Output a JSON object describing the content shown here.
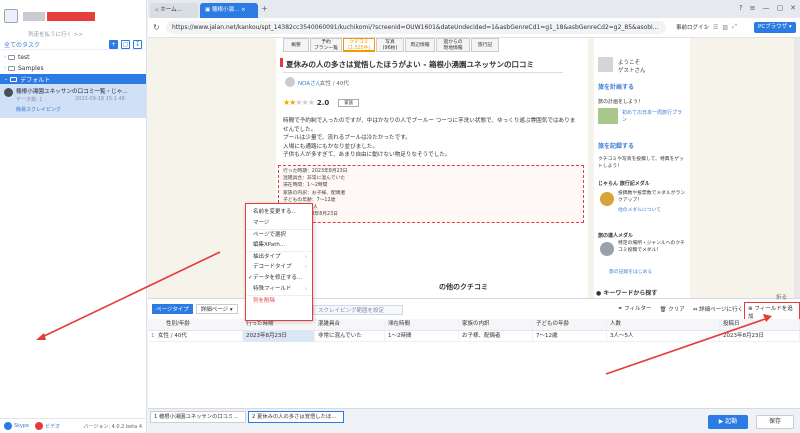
{
  "sidebar": {
    "subtitle": "列走を払うに行く >>",
    "tasks_header": "全てのタスク",
    "tree": [
      "test",
      "Samples",
      "デフォルト"
    ],
    "task": {
      "title": "穂根小湯園ユネッサンの口コミ一覧・じゃ...",
      "status": "データ数: 1",
      "date": "2023-09-18 15:1 48",
      "tag": "簡易スクレイピング"
    },
    "footer": {
      "skype": "Skype",
      "video": "ビデオ",
      "version": "バージョン: 4.0.2 beta 4"
    }
  },
  "browser": {
    "tabs": [
      "ホーム...",
      "穂根小湯..."
    ],
    "new_tab": "+",
    "url": "https://www.jalan.net/kankou/spt_14382cc3540060091/kuchikomi/?screenid=OUW1601&dateUndecided=1&asbGenreCd1=g1_18&asbGenreCd2=g2_85&asobi...",
    "login": "事前ログイン",
    "pc_browser": "PCブラウザ"
  },
  "page": {
    "nav": [
      [
        "概要",
        ""
      ],
      [
        "予約",
        "プラン一覧"
      ],
      [
        "クチコミ",
        "(2,325件)"
      ],
      [
        "写真",
        "(96枚)"
      ],
      [
        "周辺情報",
        ""
      ],
      [
        "過からの",
        "現地情報"
      ],
      [
        "旅行記",
        ""
      ]
    ],
    "title": "夏休みの人の多さは覚悟したほうがよい - 箱根小湧園ユネッサンの口コミ",
    "reviewer": "NOAさん",
    "reviewer_meta": "女性 / 40代",
    "rating": "2.0",
    "rating_badge": "家族",
    "body": [
      "時間で予約制で入ったのですが、中はかなりの人でプールー つーつに芋洗い状態で、ゆっくり遊ぶ雰囲気ではありま",
      "せんでした。",
      "プールは少量で、流れるプールは冷たかったです。",
      "入場にも通路にもかなり並びました。",
      "子供も人が多すぎて、あまり自由に動けない物足りなそうでした。"
    ],
    "details": [
      "行った時期：2023年8月23日",
      "混雑具合：非常に混んでいた",
      "滞在時間：1～2時間",
      "家族の内訳：お子様、配偶者",
      "子どもの年齢：7～12歳",
      "人数：3人～5人",
      "投稿日：2023年8月23日"
    ],
    "other_reviews": "の他のクチコミ",
    "right": {
      "welcome": "ようこそ",
      "guest": "ゲストさん",
      "plan": "旅を計画する",
      "plan_txt": "旅の計画をしよう！",
      "plan_items": "初めての日本一周旅行プラン",
      "record": "旅を記録する",
      "record_txt": "クチコミや写真を投稿して、特典をゲットしよう！",
      "medal": "じゃらん 旅行記メダル",
      "medal_txt": "投稿数や投票数でメダルがランクアップ！",
      "medal_link": "他のメダルについて",
      "master": "旅の達人メダル",
      "master_txt": "特定の場所・ジャンルへのクチコミ投稿でメダル!",
      "record_link": "旅の記録をはじめる",
      "keyword": "キーワードから探す"
    }
  },
  "lower": {
    "type_tabs": [
      "ページタイプ",
      "詳細ページ"
    ],
    "pagination": "スクレイピング範囲を設定",
    "filter": "フィルター",
    "clear": "クリア",
    "detail": "詳細ページに行く",
    "add_field": "フィールドを追加",
    "collapse": "折る",
    "columns": [
      "性別/年齢",
      "行った時期",
      "混雑具合",
      "滞在時間",
      "家族の内訳",
      "子どもの年齢",
      "人数",
      "投稿日"
    ],
    "row": [
      "女性 / 40代",
      "2023年8月23日",
      "非常に混んでいた",
      "1～2時間",
      "お子様、配偶者",
      "7～12歳",
      "3人～5人",
      "2023年8月23日"
    ],
    "row_no": "1"
  },
  "context_menu": [
    "名前を変更する...",
    "マージ",
    "ページで選択",
    "編集XPath...",
    "抽出タイプ",
    "デコードタイプ",
    "データを修正する...",
    "特殊フィールド",
    "列を削除"
  ],
  "bottom": {
    "tasks": [
      "1 穂根小湯園ユネッサンの口コミ...",
      "2 夏休みの人の多さは覚悟したほ..."
    ],
    "start": "起動",
    "save": "保存"
  }
}
